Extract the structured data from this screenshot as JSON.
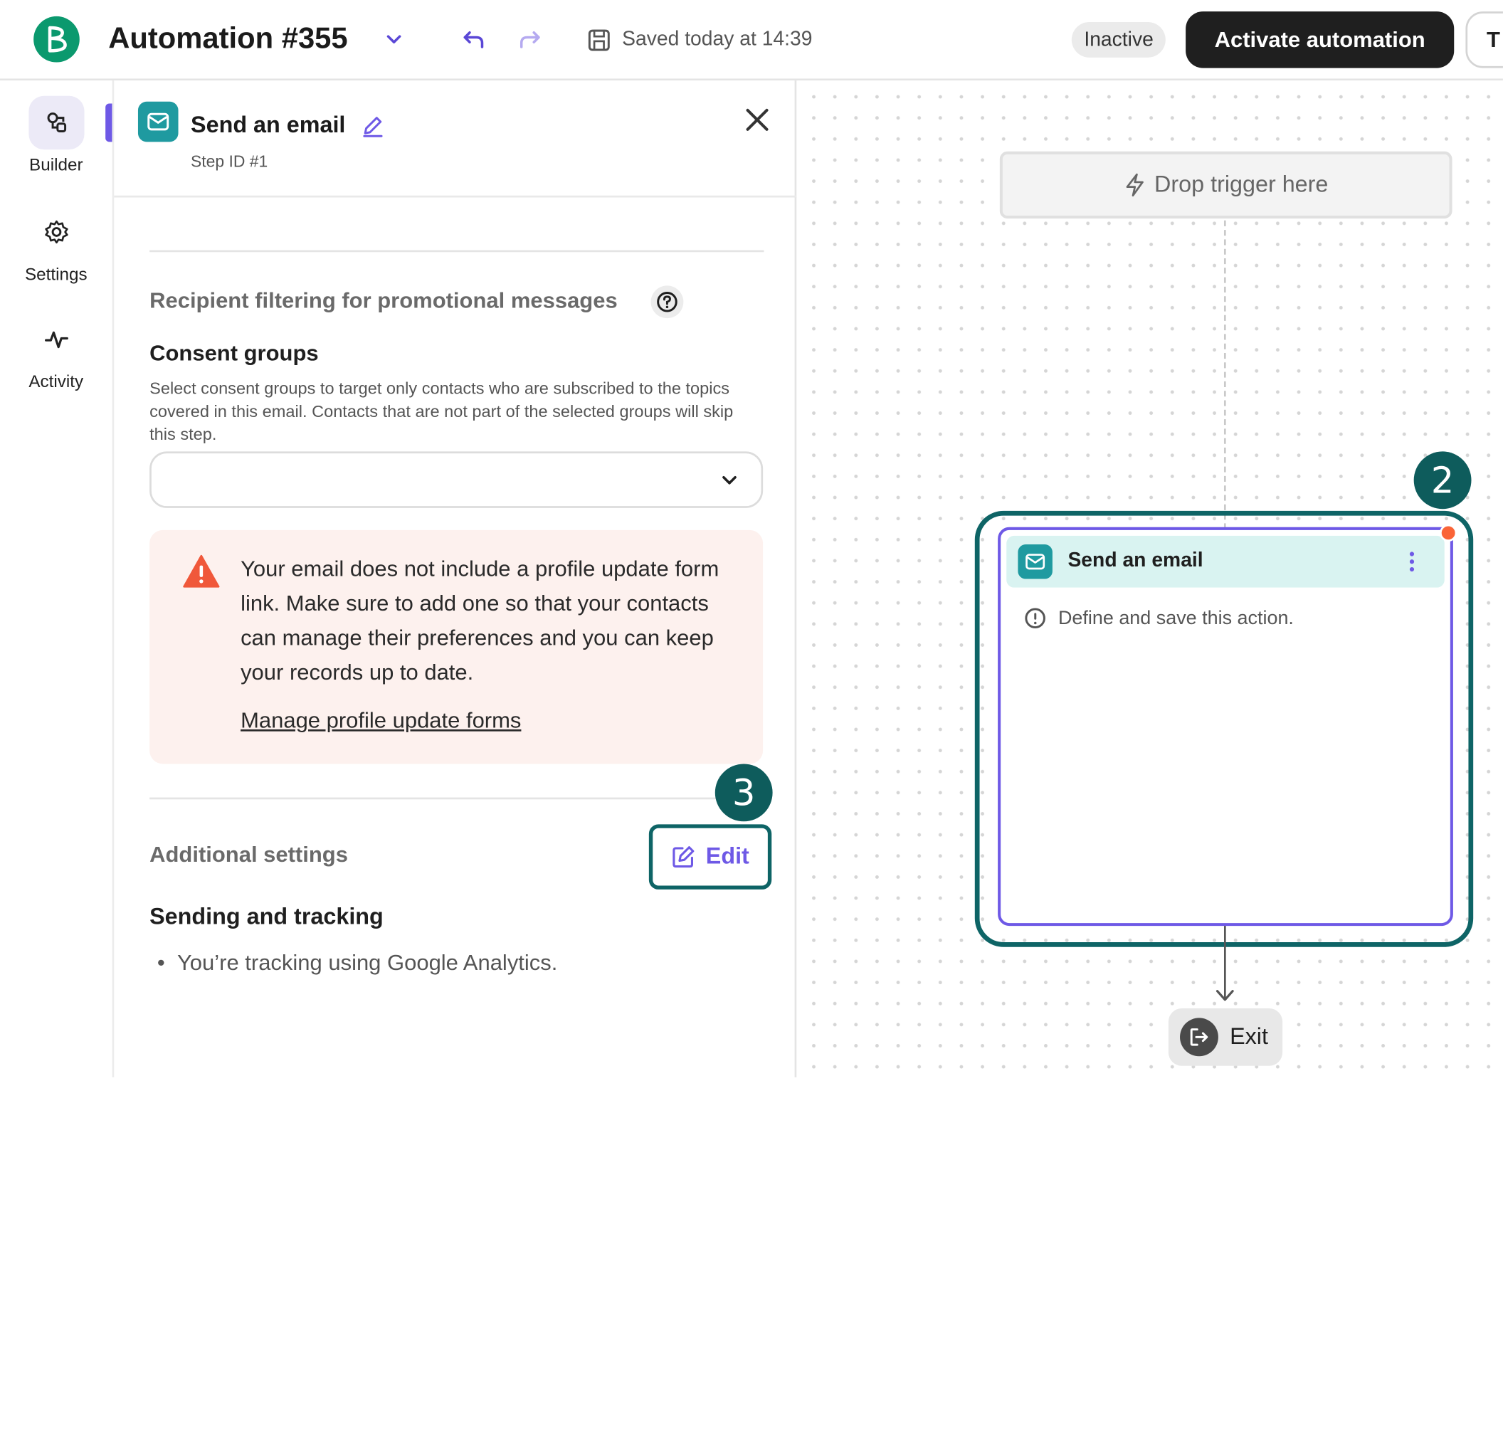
{
  "header": {
    "title": "Automation #355",
    "saved_status": "Saved today at 14:39",
    "status_badge": "Inactive",
    "activate_label": "Activate automation",
    "extra_button_label": "T"
  },
  "sidebar": {
    "items": [
      {
        "label": "Builder",
        "icon": "builder-icon",
        "active": true
      },
      {
        "label": "Settings",
        "icon": "gear-icon",
        "active": false
      },
      {
        "label": "Activity",
        "icon": "activity-icon",
        "active": false
      }
    ]
  },
  "panel": {
    "title": "Send an email",
    "step_id": "Step ID #1",
    "recipient_section_title": "Recipient filtering for promotional messages",
    "consent_title": "Consent groups",
    "consent_description": "Select consent groups to target only contacts who are subscribed to the topics covered in this email. Contacts that are not part of the selected groups will skip this step.",
    "consent_select_value": "",
    "alert_text": "Your email does not include a profile update form link. Make sure to add one so that your contacts can manage their preferences and you can keep your records up to date.",
    "alert_link": "Manage profile update forms",
    "additional_settings_title": "Additional settings",
    "edit_label": "Edit",
    "sending_title": "Sending and tracking",
    "tracking_bullet": "You’re tracking using Google Analytics."
  },
  "canvas": {
    "trigger_placeholder": "Drop trigger here",
    "node_title": "Send an email",
    "node_message": "Define and save this action.",
    "exit_label": "Exit"
  },
  "annotations": {
    "badge_canvas": "2",
    "badge_edit": "3"
  },
  "colors": {
    "brand_green": "#0b996e",
    "accent_purple": "#6e59e6",
    "highlight_teal": "#0e6466",
    "email_tile": "#1f9aa0",
    "warning_orange": "#fa6437"
  }
}
